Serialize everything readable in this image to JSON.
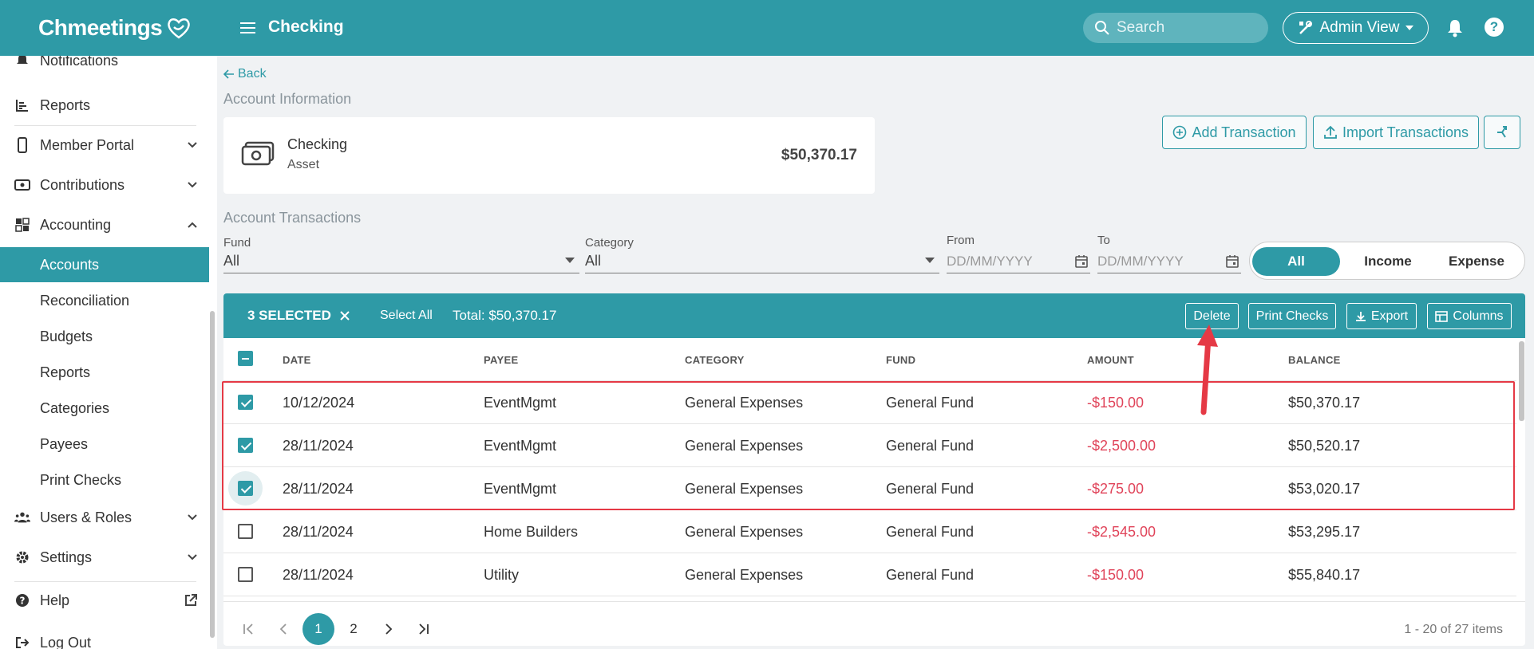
{
  "app": {
    "logo": "Chmeetings",
    "page_title": "Checking"
  },
  "header": {
    "search_placeholder": "Search",
    "admin_view": "Admin View"
  },
  "sidebar": {
    "items": [
      {
        "label": "Notifications"
      },
      {
        "label": "Reports"
      },
      {
        "label": "Member Portal"
      },
      {
        "label": "Contributions"
      },
      {
        "label": "Accounting"
      },
      {
        "label": "Accounts"
      },
      {
        "label": "Reconciliation"
      },
      {
        "label": "Budgets"
      },
      {
        "label": "Reports"
      },
      {
        "label": "Categories"
      },
      {
        "label": "Payees"
      },
      {
        "label": "Print Checks"
      },
      {
        "label": "Users & Roles"
      },
      {
        "label": "Settings"
      },
      {
        "label": "Help"
      },
      {
        "label": "Log Out"
      }
    ]
  },
  "main": {
    "back": "Back",
    "account_info_label": "Account Information",
    "account": {
      "name": "Checking",
      "type": "Asset",
      "balance": "$50,370.17"
    },
    "actions": {
      "add": "Add Transaction",
      "import": "Import Transactions"
    },
    "transactions_label": "Account Transactions",
    "filters": {
      "fund_label": "Fund",
      "fund_value": "All",
      "category_label": "Category",
      "category_value": "All",
      "from_label": "From",
      "from_placeholder": "DD/MM/YYYY",
      "to_label": "To",
      "to_placeholder": "DD/MM/YYYY",
      "segments": [
        "All",
        "Income",
        "Expense"
      ],
      "active_segment": "All"
    },
    "selection_bar": {
      "count": "3 SELECTED",
      "select_all": "Select All",
      "total": "Total:  $50,370.17",
      "delete": "Delete",
      "print_checks": "Print Checks",
      "export": "Export",
      "columns": "Columns"
    },
    "table": {
      "headers": [
        "DATE",
        "PAYEE",
        "CATEGORY",
        "FUND",
        "AMOUNT",
        "BALANCE"
      ],
      "rows": [
        {
          "checked": true,
          "date": "10/12/2024",
          "payee": "EventMgmt",
          "category": "General Expenses",
          "fund": "General Fund",
          "amount": "-$150.00",
          "balance": "$50,370.17"
        },
        {
          "checked": true,
          "date": "28/11/2024",
          "payee": "EventMgmt",
          "category": "General Expenses",
          "fund": "General Fund",
          "amount": "-$2,500.00",
          "balance": "$50,520.17"
        },
        {
          "checked": true,
          "date": "28/11/2024",
          "payee": "EventMgmt",
          "category": "General Expenses",
          "fund": "General Fund",
          "amount": "-$275.00",
          "balance": "$53,020.17"
        },
        {
          "checked": false,
          "date": "28/11/2024",
          "payee": "Home Builders",
          "category": "General Expenses",
          "fund": "General Fund",
          "amount": "-$2,545.00",
          "balance": "$53,295.17"
        },
        {
          "checked": false,
          "date": "28/11/2024",
          "payee": "Utility",
          "category": "General Expenses",
          "fund": "General Fund",
          "amount": "-$150.00",
          "balance": "$55,840.17"
        }
      ]
    },
    "pagination": {
      "pages": [
        "1",
        "2"
      ],
      "current": "1",
      "info": "1 - 20 of 27 items"
    }
  },
  "colors": {
    "brand": "#2e9aa6",
    "negative": "#e0445a",
    "annotation": "#e53945"
  }
}
